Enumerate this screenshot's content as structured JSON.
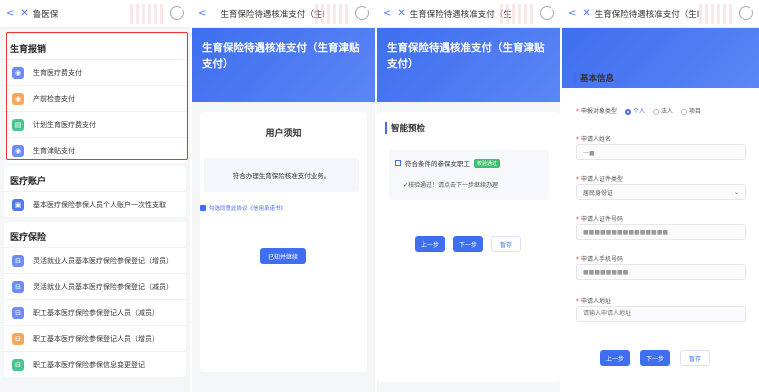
{
  "panel1": {
    "title": "鲁医保",
    "sections": [
      {
        "title": "生育报销",
        "items": [
          {
            "label": "生育医疗费支付",
            "color": "#6d8cf7"
          },
          {
            "label": "产前检查支付",
            "color": "#f8a65a"
          },
          {
            "label": "计划生育医疗费支付",
            "color": "#47c48f"
          },
          {
            "label": "生育津贴支付",
            "color": "#6d8cf7"
          }
        ]
      },
      {
        "title": "医疗账户",
        "items": [
          {
            "label": "基本医疗保险参保人员个人账户一次性支取",
            "color": "#4f77ef"
          }
        ]
      },
      {
        "title": "医疗保险",
        "items": [
          {
            "label": "灵活就业人员基本医疗保险参保登记（增员）",
            "color": "#6d8cf7"
          },
          {
            "label": "灵活就业人员基本医疗保险参保登记（减员）",
            "color": "#6d8cf7"
          },
          {
            "label": "职工基本医疗保险参保登记人员（减员）",
            "color": "#6d8cf7"
          },
          {
            "label": "职工基本医疗保险参保登记人员（增员）",
            "color": "#f8a65a"
          },
          {
            "label": "职工基本医疗保险参保信息变更登记",
            "color": "#47c48f"
          }
        ]
      }
    ]
  },
  "panel2": {
    "header": "生育保险待遇核准支付（生I",
    "banner": "生育保险待遇核准支付（生育津贴支付）",
    "notice_title": "用户须知",
    "notice_text": "符合办理生育保险核准支付业务。",
    "agree_text": "勾选同意此协议《信用承诺书》",
    "button": "已知并继续"
  },
  "panel3": {
    "header": "生育保险待遇核准支付（生I",
    "banner": "生育保险待遇核准支付（生育津贴支付）",
    "section": "智能预检",
    "check_label": "符合条件的参保女职工",
    "check_badge": "校验通过",
    "check_pass": "核验通过！请点击下一步继续办理",
    "prev": "上一步",
    "next": "下一步",
    "save": "暂存"
  },
  "panel4": {
    "header": "生育保险待遇核准支付（生I",
    "section": "基本信息",
    "applicant_type_label": "申报对象类型",
    "applicant_types": [
      "个人",
      "法人",
      "项目"
    ],
    "name_label": "申请人姓名",
    "name_value": "一■",
    "id_type_label": "申请人证件类型",
    "id_type_value": "居民身份证",
    "id_no_label": "申请人证件号码",
    "id_no_value": "■■■■■■■■■■■■■■■",
    "phone_label": "申请人手机号码",
    "phone_value": "■■■■■■■■",
    "addr_label": "申请人地址",
    "addr_placeholder": "请输入申请人地址",
    "prev": "上一步",
    "next": "下一步",
    "save": "暂存"
  }
}
